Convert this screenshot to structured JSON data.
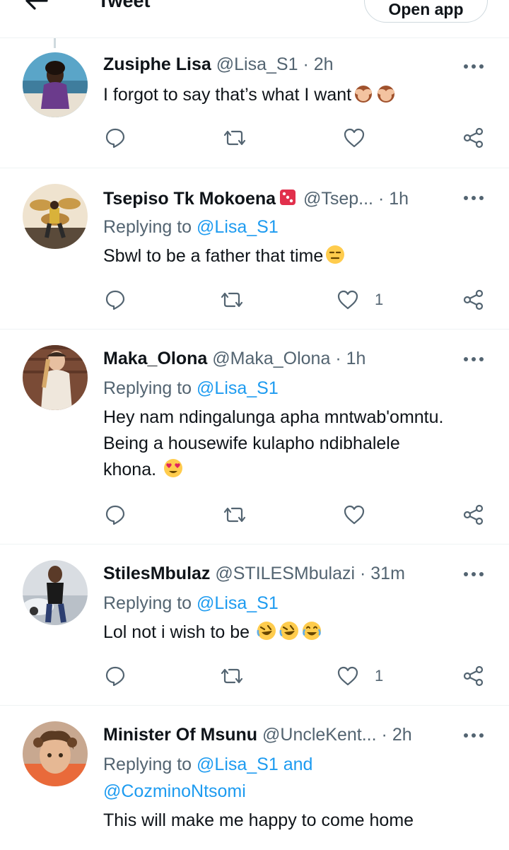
{
  "header": {
    "title": "Tweet",
    "open_app_label": "Open app"
  },
  "tweets": [
    {
      "name": "Zusiphe Lisa",
      "handle": "@Lisa_S1",
      "separator": "·",
      "time": "2h",
      "text": "I forgot to say that’s what I want",
      "emojis": [
        "see-no-evil-monkey",
        "see-no-evil-monkey"
      ],
      "like_count": ""
    },
    {
      "name": "Tsepiso Tk Mokoena",
      "name_emoji": "game-die",
      "handle": "@Tsep...",
      "separator": "·",
      "time": "1h",
      "replying_prefix": "Replying to",
      "replying_to": "@Lisa_S1",
      "text": "Sbwl to be a father that time",
      "emojis": [
        "expressionless-face"
      ],
      "like_count": "1"
    },
    {
      "name": "Maka_Olona",
      "handle": "@Maka_Olona",
      "separator": "·",
      "time": "1h",
      "replying_prefix": "Replying to",
      "replying_to": "@Lisa_S1",
      "text_lines": [
        "Hey nam ndingalunga apha mntwab'omntu.",
        "Being a housewife kulapho ndibhalele",
        "khona."
      ],
      "emojis": [
        "heart-eyes-face"
      ],
      "like_count": ""
    },
    {
      "name": "StilesMbulaz",
      "handle": "@STILESMbulazi",
      "separator": "·",
      "time": "31m",
      "replying_prefix": "Replying to",
      "replying_to": "@Lisa_S1",
      "text": "Lol not i wish to be",
      "emojis": [
        "rolling-laughing-face",
        "rolling-laughing-face",
        "tears-of-joy-face"
      ],
      "like_count": "1"
    },
    {
      "name": "Minister Of Msunu",
      "handle": "@UncleKent...",
      "separator": "·",
      "time": "2h",
      "replying_prefix": "Replying to",
      "replying_to": "@Lisa_S1 and",
      "replying_to_2": "@CozminoNtsomi",
      "text": "This will make me happy to come home",
      "like_count": ""
    }
  ],
  "colors": {
    "link": "#1d9bf0",
    "secondary": "#536471",
    "divider": "#eff3f4"
  }
}
